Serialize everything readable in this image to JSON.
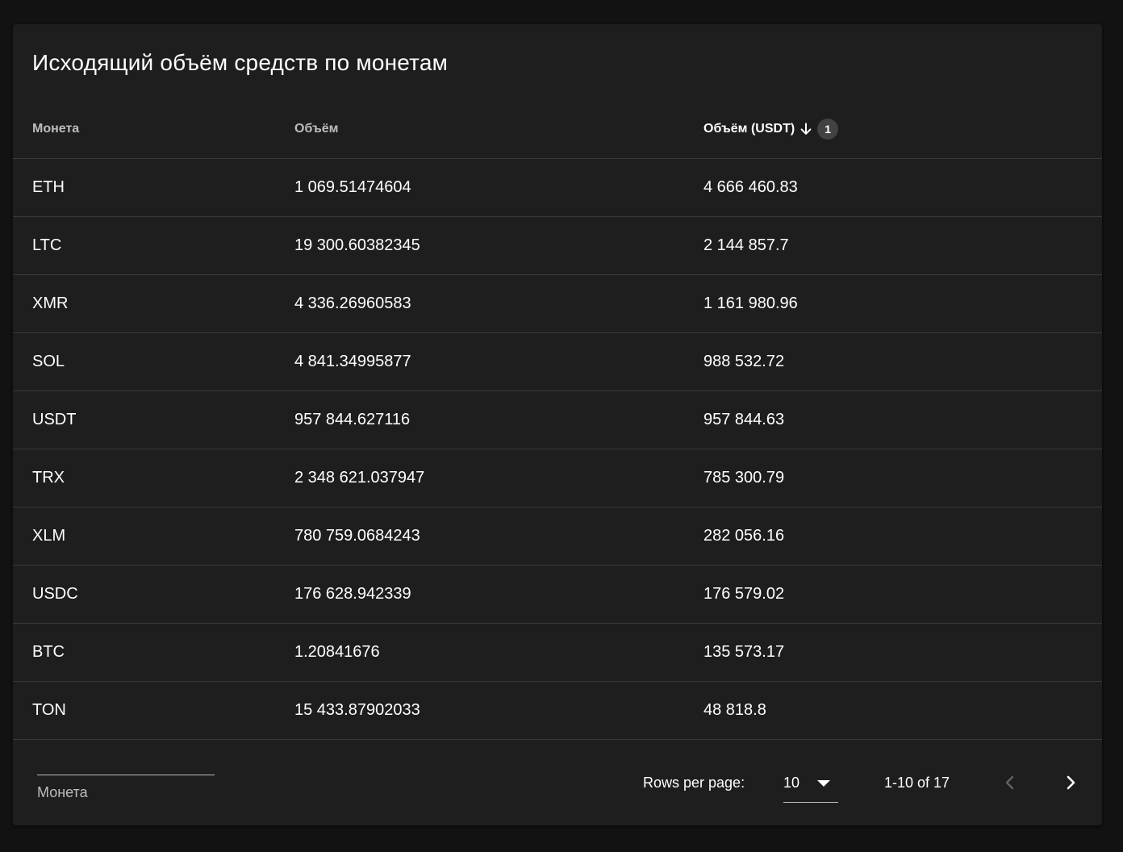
{
  "card": {
    "title": "Исходящий объём средств по монетам"
  },
  "table": {
    "columns": [
      {
        "label": "Монета"
      },
      {
        "label": "Объём"
      },
      {
        "label": "Объём (USDT)",
        "sort_direction": "desc",
        "sort_priority": "1"
      }
    ],
    "rows": [
      {
        "coin": "ETH",
        "volume": "1 069.51474604",
        "volume_usdt": "4 666 460.83"
      },
      {
        "coin": "LTC",
        "volume": "19 300.60382345",
        "volume_usdt": "2 144 857.7"
      },
      {
        "coin": "XMR",
        "volume": "4 336.26960583",
        "volume_usdt": "1 161 980.96"
      },
      {
        "coin": "SOL",
        "volume": "4 841.34995877",
        "volume_usdt": "988 532.72"
      },
      {
        "coin": "USDT",
        "volume": "957 844.627116",
        "volume_usdt": "957 844.63"
      },
      {
        "coin": "TRX",
        "volume": "2 348 621.037947",
        "volume_usdt": "785 300.79"
      },
      {
        "coin": "XLM",
        "volume": "780 759.0684243",
        "volume_usdt": "282 056.16"
      },
      {
        "coin": "USDC",
        "volume": "176 628.942339",
        "volume_usdt": "176 579.02"
      },
      {
        "coin": "BTC",
        "volume": "1.20841676",
        "volume_usdt": "135 573.17"
      },
      {
        "coin": "TON",
        "volume": "15 433.87902033",
        "volume_usdt": "48 818.8"
      }
    ]
  },
  "footer": {
    "filter_label": "Монета",
    "rows_per_page_label": "Rows per page:",
    "rows_per_page_value": "10",
    "range_text": "1-10 of 17",
    "prev_icon": "chevron-left-icon",
    "next_icon": "chevron-right-icon"
  }
}
